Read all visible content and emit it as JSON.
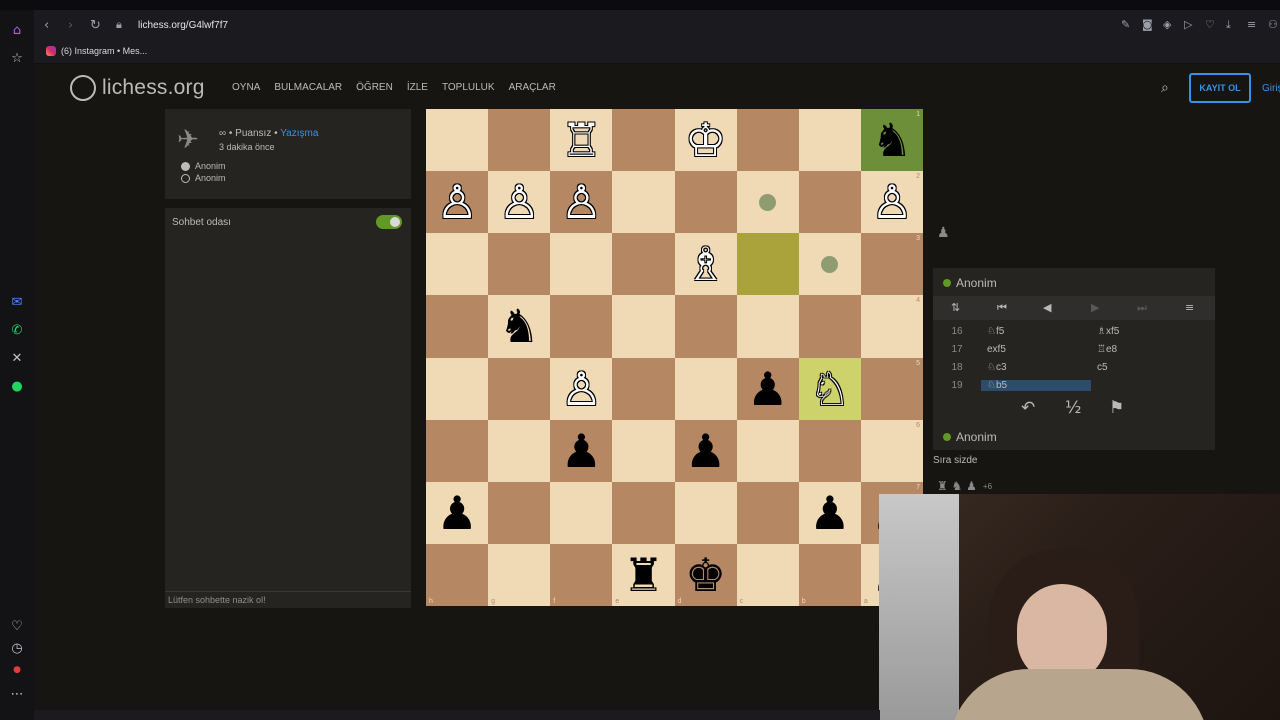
{
  "browser": {
    "url": "lichess.org/G4lwf7f7",
    "bookmark": "(6) Instagram • Mes...",
    "rail_icons": [
      "home-icon",
      "pin-icon",
      "messenger-icon",
      "whatsapp-icon",
      "x-twitter-icon",
      "spotify-icon",
      "heart-icon",
      "clock-icon",
      "more-icon"
    ]
  },
  "site": {
    "logo_text": "lichess.org",
    "nav": [
      "OYNA",
      "BULMACALAR",
      "ÖĞREN",
      "İZLE",
      "TOPLULUK",
      "ARAÇLAR"
    ],
    "signup": "KAYIT OL",
    "login": "Giriş"
  },
  "game_info": {
    "type_prefix": "∞ • Puansız •",
    "type_link": "Yazışma",
    "time_ago": "3 dakika önce",
    "players": [
      {
        "name": "Anonim",
        "color": "white"
      },
      {
        "name": "Anonim",
        "color": "black"
      }
    ]
  },
  "chat": {
    "title": "Sohbet odası",
    "placeholder": "Lütfen sohbette nazik ol!"
  },
  "board": {
    "orientation": "black",
    "ranks": [
      "1",
      "2",
      "3",
      "4",
      "5",
      "6",
      "7",
      "8"
    ],
    "files": [
      "h",
      "g",
      "f",
      "e",
      "d",
      "c",
      "b",
      "a"
    ],
    "squares": [
      [
        "",
        "",
        "♖",
        "",
        "♔",
        "",
        "",
        "♞"
      ],
      [
        "♙",
        "♙",
        "♙",
        "",
        "",
        "•",
        "",
        "♙"
      ],
      [
        "",
        "",
        "",
        "",
        "♗",
        "",
        "•",
        ""
      ],
      [
        "",
        "♞",
        "",
        "",
        "",
        "",
        "",
        ""
      ],
      [
        "",
        "",
        "♙",
        "",
        "",
        "♟",
        "♘",
        ""
      ],
      [
        "",
        "",
        "♟",
        "",
        "♟",
        "",
        "",
        ""
      ],
      [
        "♟",
        "",
        "",
        "",
        "",
        "",
        "♟",
        "♟"
      ],
      [
        "",
        "",
        "",
        "♜",
        "♚",
        "",
        "",
        "♟"
      ]
    ],
    "colors": {
      "light": "#f0d9b5",
      "dark": "#b58863",
      "highlight": "#aaa23a",
      "selected": "#6d8f3a"
    }
  },
  "panel": {
    "top_player": "Anonim",
    "bottom_player": "Anonim",
    "turn_text": "Sıra sizde",
    "captured_top": "♟",
    "captured_bottom": "♜ ♞ ♟",
    "material_adv": "+6",
    "moves": [
      {
        "num": "16",
        "white": "♘f5",
        "black": "♗xf5"
      },
      {
        "num": "17",
        "white": "exf5",
        "black": "♖e8"
      },
      {
        "num": "18",
        "white": "♘c3",
        "black": "c5"
      },
      {
        "num": "19",
        "white": "♘b5",
        "black": ""
      }
    ],
    "actions": {
      "takeback": "↶",
      "draw": "½",
      "resign": "⚑"
    }
  }
}
